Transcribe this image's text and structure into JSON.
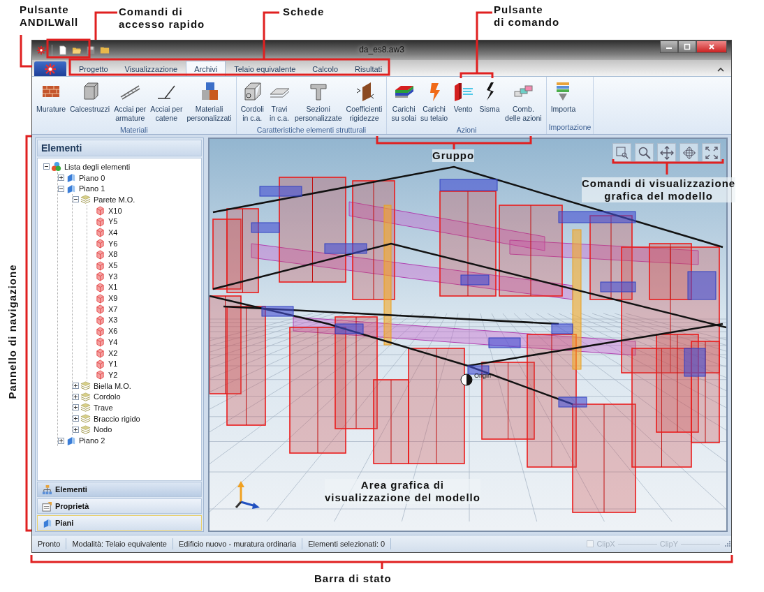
{
  "callouts": [
    {
      "lines": [
        "Pulsante",
        "ANDILWall"
      ]
    },
    {
      "lines": [
        "Comandi di",
        "accesso rapido"
      ]
    },
    {
      "lines": [
        "Schede"
      ]
    },
    {
      "lines": [
        "Pulsante",
        "di comando"
      ]
    },
    {
      "lines": [
        "Gruppo"
      ]
    },
    {
      "lines": [
        "Comandi di visualizzazione",
        "grafica del modello"
      ]
    },
    {
      "lines": [
        "Area grafica di",
        "visualizzazione del modello"
      ]
    },
    {
      "lines": [
        "Pannello di navigazione"
      ]
    },
    {
      "lines": [
        "Barra di stato"
      ]
    }
  ],
  "window": {
    "title": "da_es8.aw3"
  },
  "tabs": [
    {
      "label": "Progetto",
      "selected": false
    },
    {
      "label": "Visualizzazione",
      "selected": false
    },
    {
      "label": "Archivi",
      "selected": true
    },
    {
      "label": "Telaio equivalente",
      "selected": false
    },
    {
      "label": "Calcolo",
      "selected": false
    },
    {
      "label": "Risultati",
      "selected": false
    }
  ],
  "ribbon": {
    "groups": [
      {
        "label": "Materiali",
        "buttons": [
          {
            "label": "Murature",
            "kind": "bricks"
          },
          {
            "label": "Calcestruzzi",
            "kind": "cube"
          },
          {
            "label": "Acciai per\narmature",
            "kind": "rebar"
          },
          {
            "label": "Acciai per\ncatene",
            "kind": "wire"
          },
          {
            "label": "Materiali\npersonalizzati",
            "kind": "materials"
          }
        ]
      },
      {
        "label": "Caratteristiche elementi strutturali",
        "buttons": [
          {
            "label": "Cordoli\nin c.a.",
            "kind": "curb"
          },
          {
            "label": "Travi\nin c.a.",
            "kind": "beam"
          },
          {
            "label": "Sezioni\npersonalizzate",
            "kind": "section"
          },
          {
            "label": "Coefficienti\nrigidezze",
            "kind": "stiffness"
          }
        ]
      },
      {
        "label": "Azioni",
        "buttons": [
          {
            "label": "Carichi\nsu solai",
            "kind": "slab"
          },
          {
            "label": "Carichi\nsu telaio",
            "kind": "load"
          },
          {
            "label": "Vento",
            "kind": "wind"
          },
          {
            "label": "Sisma",
            "kind": "quake"
          },
          {
            "label": "Comb.\ndelle azioni",
            "kind": "combo"
          }
        ]
      },
      {
        "label": "Importazione",
        "buttons": [
          {
            "label": "Importa",
            "kind": "import"
          }
        ]
      }
    ]
  },
  "navigation_panel": {
    "title": "Elementi",
    "tree": [
      {
        "label": "Lista degli elementi",
        "kind": "root",
        "expanded": true,
        "children": [
          {
            "label": "Piano 0",
            "kind": "floor",
            "expanded": false
          },
          {
            "label": "Piano 1",
            "kind": "floor",
            "expanded": true,
            "children": [
              {
                "label": "Parete M.O.",
                "kind": "group",
                "expanded": true,
                "children": [
                  {
                    "label": "X10",
                    "kind": "wall"
                  },
                  {
                    "label": "Y5",
                    "kind": "wall"
                  },
                  {
                    "label": "X4",
                    "kind": "wall"
                  },
                  {
                    "label": "Y6",
                    "kind": "wall"
                  },
                  {
                    "label": "X8",
                    "kind": "wall"
                  },
                  {
                    "label": "X5",
                    "kind": "wall"
                  },
                  {
                    "label": "Y3",
                    "kind": "wall"
                  },
                  {
                    "label": "X1",
                    "kind": "wall"
                  },
                  {
                    "label": "X9",
                    "kind": "wall"
                  },
                  {
                    "label": "X7",
                    "kind": "wall"
                  },
                  {
                    "label": "X3",
                    "kind": "wall"
                  },
                  {
                    "label": "X6",
                    "kind": "wall"
                  },
                  {
                    "label": "Y4",
                    "kind": "wall"
                  },
                  {
                    "label": "X2",
                    "kind": "wall"
                  },
                  {
                    "label": "Y1",
                    "kind": "wall"
                  },
                  {
                    "label": "Y2",
                    "kind": "wall"
                  }
                ]
              },
              {
                "label": "Biella M.O.",
                "kind": "group",
                "expanded": false
              },
              {
                "label": "Cordolo",
                "kind": "group",
                "expanded": false
              },
              {
                "label": "Trave",
                "kind": "group",
                "expanded": false
              },
              {
                "label": "Braccio rigido",
                "kind": "group",
                "expanded": false
              },
              {
                "label": "Nodo",
                "kind": "group",
                "expanded": false
              }
            ]
          },
          {
            "label": "Piano 2",
            "kind": "floor",
            "expanded": false
          }
        ]
      }
    ],
    "panes": [
      {
        "label": "Elementi",
        "kind": "hierarchy",
        "selected": true,
        "hovered": false
      },
      {
        "label": "Proprietà",
        "kind": "properties",
        "selected": false,
        "hovered": false
      },
      {
        "label": "Piani",
        "kind": "floors",
        "selected": false,
        "hovered": true
      }
    ]
  },
  "viewport": {
    "origin_label": "Origin"
  },
  "status_bar": {
    "fields": [
      "Pronto",
      "Modalità: Telaio equivalente",
      "Edificio nuovo - muratura ordinaria",
      "Elementi selezionati: 0"
    ],
    "clip_x": {
      "label": "ClipX",
      "checked": false,
      "disabled": true
    },
    "clip_y": {
      "label": "ClipY",
      "disabled": true
    }
  }
}
